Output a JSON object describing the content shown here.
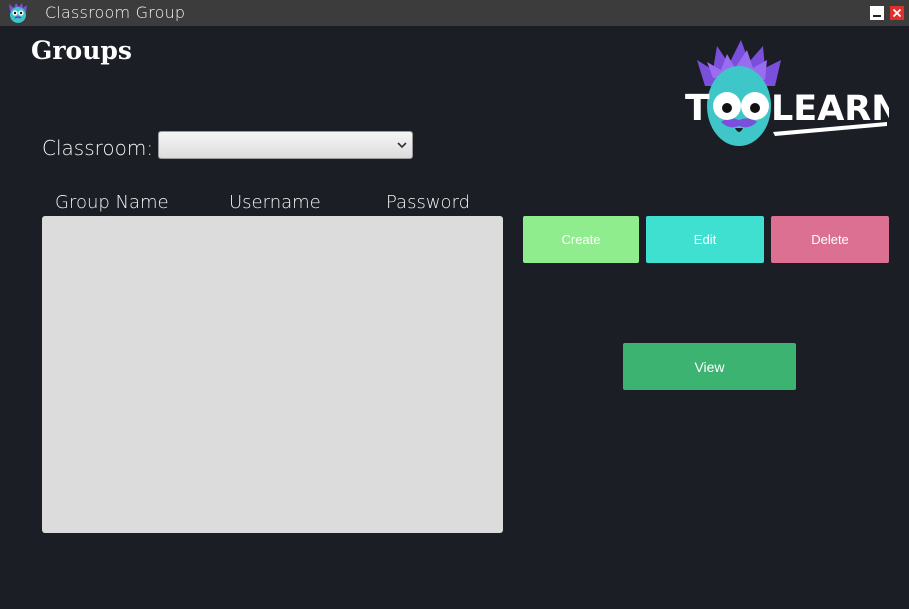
{
  "window": {
    "title": "Classroom Group",
    "icon": "toolearn-mascot-icon"
  },
  "page": {
    "title": "Groups"
  },
  "logo": {
    "text_left": "T",
    "text_right": "LEARN",
    "brand": "TOOLEARN"
  },
  "classroom": {
    "label": "Classroom:",
    "selected_value": ""
  },
  "table": {
    "columns": [
      "Group Name",
      "Username",
      "Password"
    ],
    "rows": []
  },
  "actions": {
    "create_label": "Create",
    "edit_label": "Edit",
    "delete_label": "Delete",
    "view_label": "View"
  },
  "colors": {
    "background": "#1b1e25",
    "create": "#90ed8d",
    "edit": "#40e0d0",
    "delete": "#db7093",
    "view": "#3cb371",
    "list_bg": "#dcdcdc"
  }
}
